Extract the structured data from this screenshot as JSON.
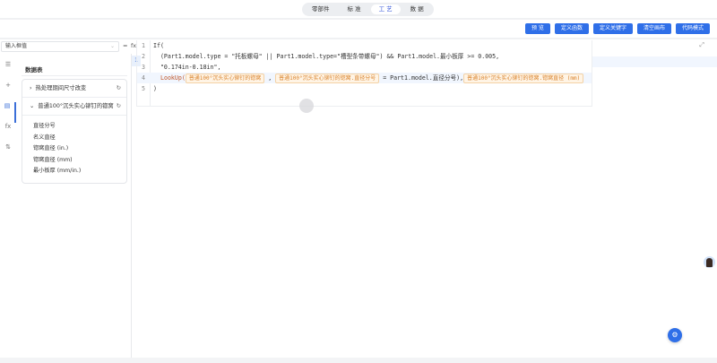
{
  "tabs": [
    {
      "label": "零部件"
    },
    {
      "label": "标 准"
    },
    {
      "label": "工 艺",
      "active": true
    },
    {
      "label": "数 据"
    }
  ],
  "toolbar": {
    "buttons": [
      "预 览",
      "定义函数",
      "定义关键字",
      "清空画布",
      "代码模式"
    ]
  },
  "formula": {
    "input_placeholder": "输入框值",
    "eq": "=",
    "fx": "fx",
    "side_line": "1"
  },
  "editor": {
    "lines": [
      {
        "n": "1",
        "text": "If("
      },
      {
        "n": "2",
        "text": "  (Part1.model.type = \"托板螺母\" || Part1.model.type=\"槽型条带螺母\") && Part1.model.最小板厚 >= 0.005,"
      },
      {
        "n": "3",
        "text": "  \"0.174in-0.18in\","
      },
      {
        "n": "4",
        "func": "LookUp(",
        "tag1": "普通100°沉头实心铆钉的锪窝",
        "comma": " , ",
        "tag2": "普通100°沉头实心铆钉的锪窝.直径分号",
        "mid": " = Part1.model.直径分号),",
        "tag3": "普通100°沉头实心铆钉的锪窝.锪窝直径 (mm)"
      },
      {
        "n": "5",
        "text": ")"
      }
    ]
  },
  "panel": {
    "title": "数据表",
    "tables": [
      {
        "label": "热处理期间尺寸改变",
        "expanded": false
      },
      {
        "label": "普通100°沉头实心铆钉的锪窝",
        "expanded": true
      }
    ],
    "fields": [
      "直径分号",
      "名义直径",
      "锪窝直径 (in.)",
      "锪窝直径 (mm)",
      "最小板厚 (mm/in.)"
    ]
  },
  "colors": {
    "accent": "#2f6fe8",
    "tag_bg": "#fff4e5",
    "tag_text": "#d9822b"
  }
}
